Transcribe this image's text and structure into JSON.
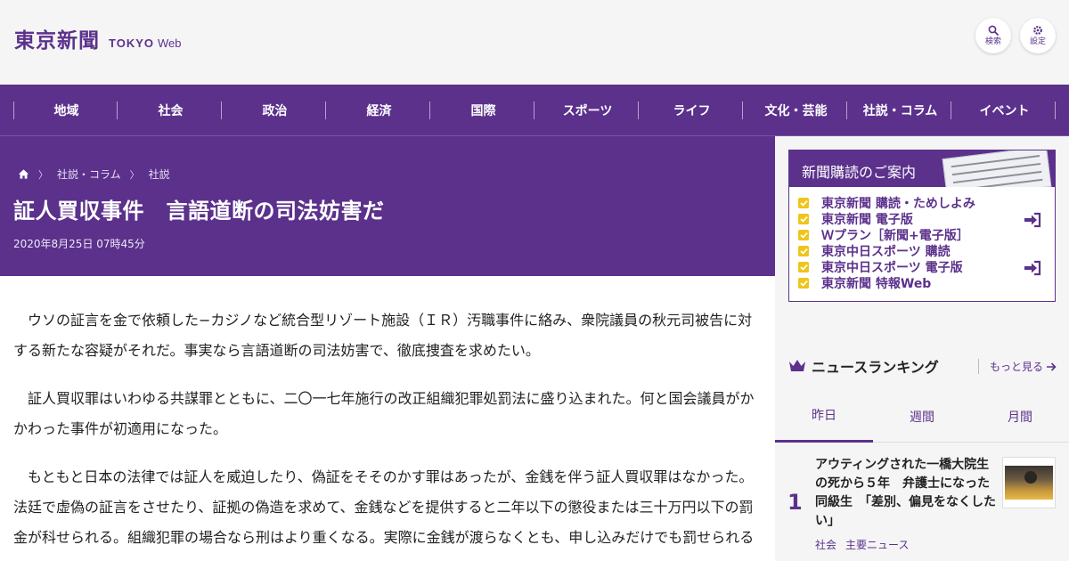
{
  "brand": {
    "kanji": "東京新聞",
    "tokyo": "TOKYO",
    "web": "Web",
    "color": "#5b318c"
  },
  "header_buttons": {
    "search": {
      "label": "検索",
      "icon": "search-icon"
    },
    "settings": {
      "label": "設定",
      "icon": "gear-icon"
    }
  },
  "nav": {
    "items": [
      "地域",
      "社会",
      "政治",
      "経済",
      "国際",
      "スポーツ",
      "ライフ",
      "文化・芸能",
      "社説・コラム",
      "イベント"
    ]
  },
  "breadcrumb": {
    "home_icon": "home-icon",
    "items": [
      "社説・コラム",
      "社説"
    ]
  },
  "article": {
    "title": "証人買収事件　言語道断の司法妨害だ",
    "date": "2020年8月25日 07時45分",
    "paragraphs": [
      "ウソの証言を金で依頼した−カジノなど統合型リゾート施設（ＩＲ）汚職事件に絡み、衆院議員の秋元司被告に対する新たな容疑がそれだ。事実なら言語道断の司法妨害で、徹底捜査を求めたい。",
      "証人買収罪はいわゆる共謀罪とともに、二〇一七年施行の改正組織犯罪処罰法に盛り込まれた。何と国会議員がかかわった事件が初適用になった。",
      "もともと日本の法律では証人を威迫したり、偽証をそそのかす罪はあったが、金銭を伴う証人買収罪はなかった。法廷で虚偽の証言をさせたり、証拠の偽造を求めて、金銭などを提供すると二年以下の懲役または三十万円以下の罰金が科せられる。組織犯罪の場合なら刑はより重くなる。実際に金銭が渡らなくとも、申し込みだけでも罰せられる"
    ]
  },
  "subscription": {
    "title": "新聞購読のご案内",
    "items": [
      "東京新聞 購読・ためしよみ",
      "東京新聞 電子版",
      "Ｗプラン［新聞+電子版］",
      "東京中日スポーツ 購読",
      "東京中日スポーツ 電子版",
      "東京新聞 特報Web"
    ],
    "check_color": "#f0c419"
  },
  "ranking": {
    "title": "ニュースランキング",
    "more": "もっと見る",
    "tabs": [
      "昨日",
      "週間",
      "月間"
    ],
    "active_tab": "昨日",
    "items": [
      {
        "rank": "1",
        "title": "アウティングされた一橋大院生の死から５年　弁護士になった同級生　「差別、偏見をなくしたい」",
        "tags": [
          "社会",
          "主要ニュース"
        ]
      }
    ]
  }
}
